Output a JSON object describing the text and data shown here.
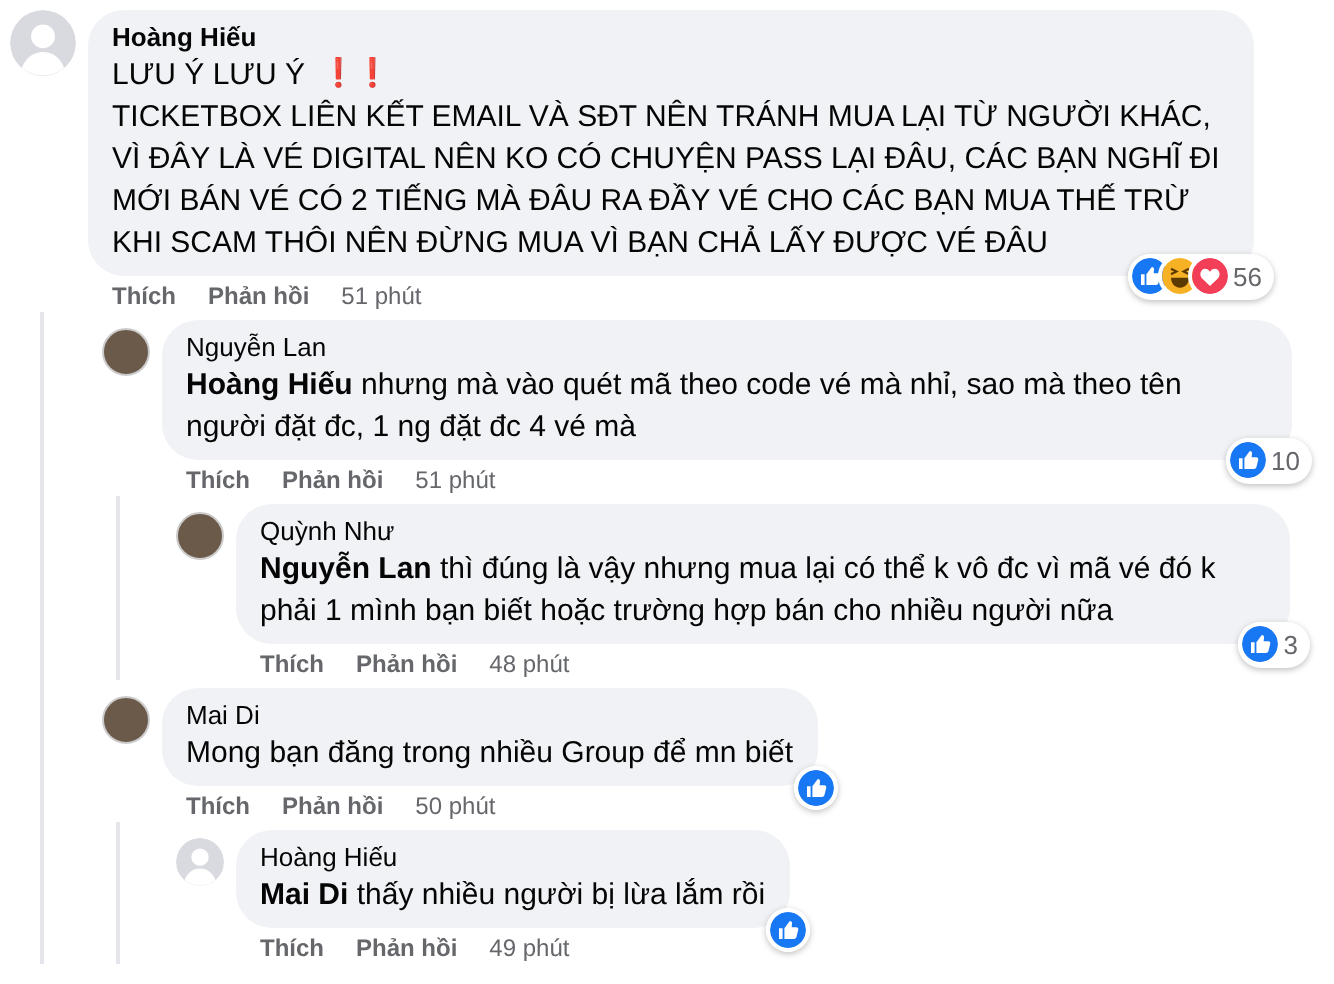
{
  "comments": [
    {
      "author": "Hoàng Hiếu",
      "avatar": {
        "kind": "silhouette"
      },
      "headline": "LƯU Ý LƯU Ý",
      "headline_marks": "❗❗",
      "text": "TICKETBOX LIÊN KẾT EMAIL VÀ SĐT NÊN TRÁNH MUA LẠI TỪ NGƯỜI KHÁC, VÌ ĐÂY LÀ VÉ DIGITAL NÊN KO CÓ CHUYỆN PASS LẠI ĐÂU, CÁC BẠN NGHĨ ĐI MỚI BÁN VÉ CÓ 2 TIẾNG MÀ ĐÂU RA ĐẦY VÉ CHO CÁC BẠN MUA THẾ TRỪ KHI SCAM THÔI NÊN ĐỪNG MUA VÌ BẠN CHẢ LẤY ĐƯỢC VÉ ĐÂU",
      "reactions": [
        {
          "kind": "like"
        },
        {
          "kind": "haha"
        },
        {
          "kind": "love"
        }
      ],
      "reaction_count": "56",
      "like_label": "Thích",
      "reply_label": "Phản hồi",
      "time": "51 phút",
      "children": [
        {
          "author": "Nguyễn Lan",
          "avatar": {
            "kind": "photo"
          },
          "text": "**Hoàng Hiếu** nhưng mà vào quét mã theo code vé mà nhỉ, sao mà theo tên người đặt đc, 1 ng đặt đc 4 vé mà",
          "reactions": [
            {
              "kind": "like"
            }
          ],
          "reaction_count": "10",
          "like_label": "Thích",
          "reply_label": "Phản hồi",
          "time": "51 phút",
          "children": [
            {
              "author": "Quỳnh Như",
              "avatar": {
                "kind": "photo"
              },
              "text": "**Nguyễn Lan** thì đúng là vậy nhưng mua lại có thể k vô đc vì mã vé đó k phải 1 mình bạn biết hoặc trường hợp bán cho nhiều người nữa",
              "reactions": [
                {
                  "kind": "like"
                }
              ],
              "reaction_count": "3",
              "like_label": "Thích",
              "reply_label": "Phản hồi",
              "time": "48 phút"
            }
          ]
        },
        {
          "author": "Mai Di",
          "avatar": {
            "kind": "photo"
          },
          "text": "Mong bạn đăng trong nhiều Group để mn biết",
          "reactions": [
            {
              "kind": "like"
            }
          ],
          "like_label": "Thích",
          "reply_label": "Phản hồi",
          "time": "50 phút",
          "children": [
            {
              "author": "Hoàng Hiếu",
              "avatar": {
                "kind": "silhouette"
              },
              "text": "**Mai Di** thấy nhiều người bị lừa lắm rồi",
              "reactions": [
                {
                  "kind": "like"
                }
              ],
              "like_label": "Thích",
              "reply_label": "Phản hồi",
              "time": "49 phút"
            }
          ]
        }
      ]
    }
  ]
}
